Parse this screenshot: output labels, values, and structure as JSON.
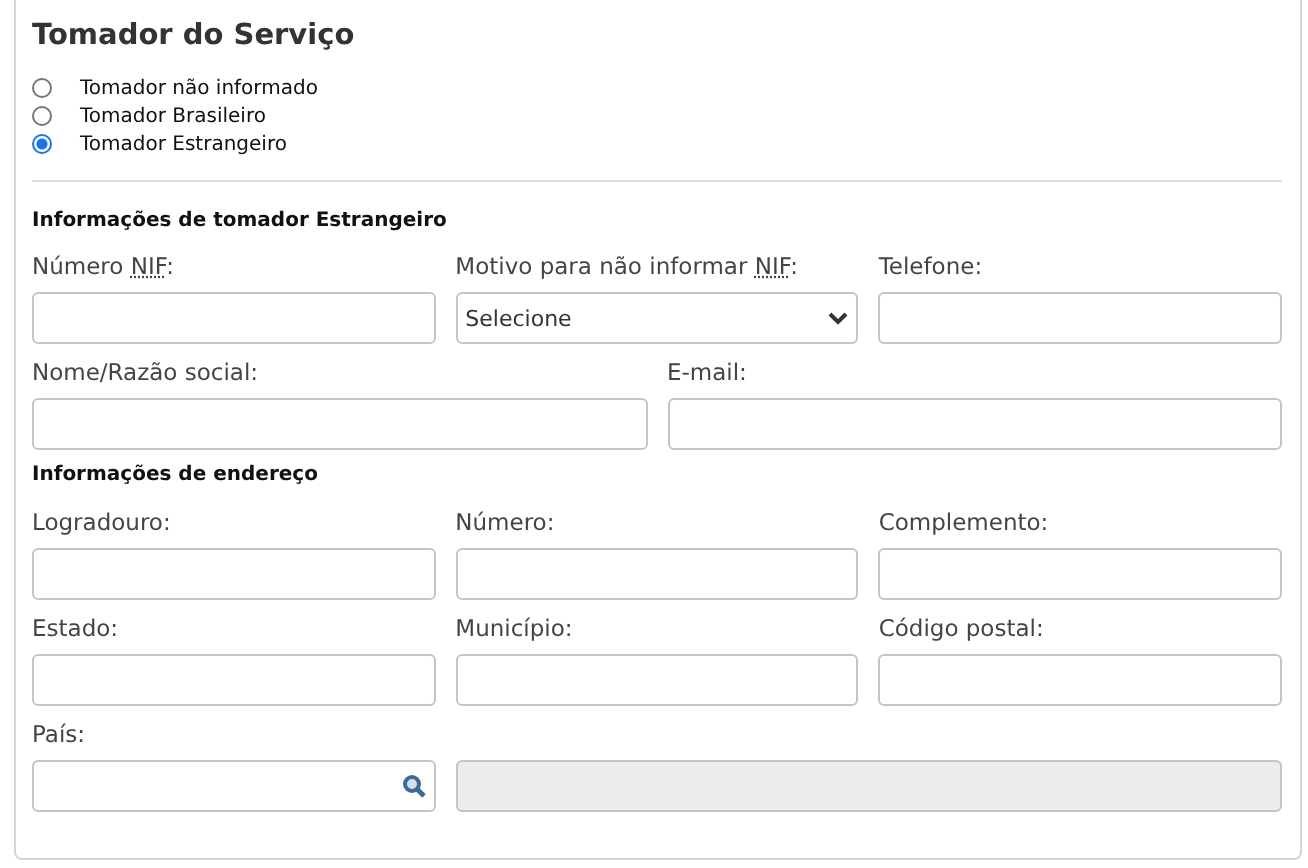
{
  "title": "Tomador do Serviço",
  "options": [
    {
      "label": "Tomador não informado",
      "selected": false
    },
    {
      "label": "Tomador Brasileiro",
      "selected": false
    },
    {
      "label": "Tomador Estrangeiro",
      "selected": true
    }
  ],
  "sections": [
    {
      "heading": "Informações de tomador Estrangeiro",
      "rows": [
        {
          "fields": [
            {
              "kind": "text",
              "label": [
                {
                  "kind": "plain",
                  "text": "Número "
                },
                {
                  "kind": "abbr",
                  "text": "NIF"
                },
                {
                  "kind": "plain",
                  "text": ":"
                }
              ]
            },
            {
              "kind": "select",
              "label": [
                {
                  "kind": "plain",
                  "text": "Motivo para não informar "
                },
                {
                  "kind": "abbr",
                  "text": "NIF"
                },
                {
                  "kind": "plain",
                  "text": ":"
                }
              ],
              "value": "Selecione"
            },
            {
              "kind": "text",
              "label": [
                {
                  "kind": "plain",
                  "text": "Telefone:"
                }
              ]
            }
          ]
        },
        {
          "fields": [
            {
              "kind": "text",
              "label": [
                {
                  "kind": "plain",
                  "text": "Nome/Razão social:"
                }
              ]
            },
            {
              "kind": "text",
              "label": [
                {
                  "kind": "plain",
                  "text": "E-mail:"
                }
              ]
            }
          ]
        }
      ]
    },
    {
      "heading": "Informações de endereço",
      "rows": [
        {
          "fields": [
            {
              "kind": "text",
              "label": [
                {
                  "kind": "plain",
                  "text": "Logradouro:"
                }
              ]
            },
            {
              "kind": "text",
              "label": [
                {
                  "kind": "plain",
                  "text": "Número:"
                }
              ]
            },
            {
              "kind": "text",
              "label": [
                {
                  "kind": "plain",
                  "text": "Complemento:"
                }
              ]
            }
          ]
        },
        {
          "fields": [
            {
              "kind": "text",
              "label": [
                {
                  "kind": "plain",
                  "text": "Estado:"
                }
              ]
            },
            {
              "kind": "text",
              "label": [
                {
                  "kind": "plain",
                  "text": "Município:"
                }
              ]
            },
            {
              "kind": "text",
              "label": [
                {
                  "kind": "plain",
                  "text": "Código postal:"
                }
              ]
            }
          ]
        },
        {
          "fields": [
            {
              "kind": "lookup",
              "label": [
                {
                  "kind": "plain",
                  "text": "País:"
                }
              ]
            },
            {
              "kind": "readonly"
            }
          ]
        }
      ]
    }
  ]
}
